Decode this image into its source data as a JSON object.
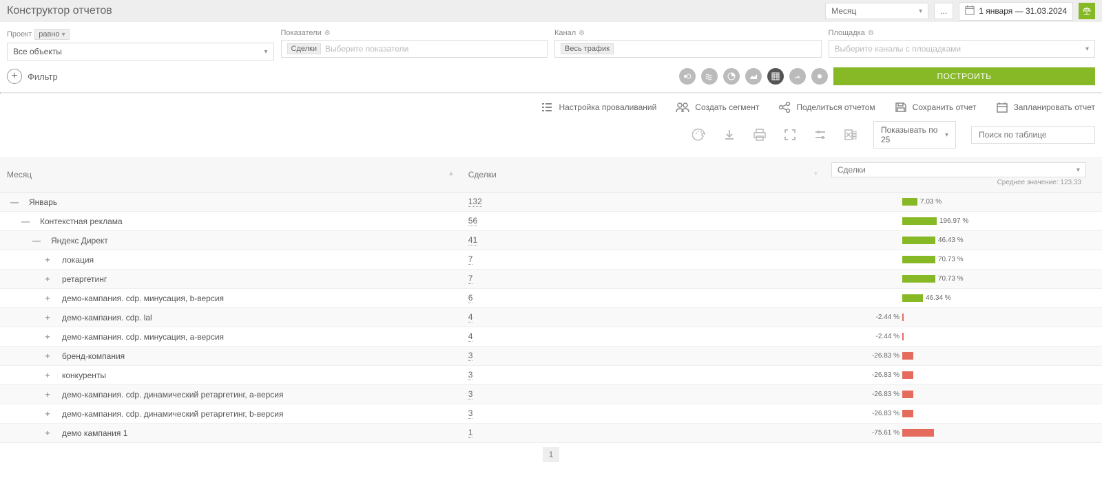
{
  "header": {
    "title": "Конструктор отчетов",
    "grouping_value": "Месяц",
    "date_range": "1 января — 31.03.2024",
    "ellipsis": "..."
  },
  "filters": {
    "project": {
      "label": "Проект",
      "op": "равно",
      "value": "Все объекты"
    },
    "metrics": {
      "label": "Показатели",
      "tag": "Сделки",
      "placeholder": "Выберите показатели"
    },
    "channel": {
      "label": "Канал",
      "tag": "Весь трафик"
    },
    "site": {
      "label": "Площадка",
      "placeholder": "Выберите каналы с площадками"
    },
    "add_filter": "Фильтр",
    "build": "ПОСТРОИТЬ"
  },
  "report_actions": {
    "drill": "Настройка проваливаний",
    "segment": "Создать сегмент",
    "share": "Поделиться отчетом",
    "save": "Сохранить отчет",
    "schedule": "Запланировать отчет"
  },
  "toolbar": {
    "page_size": "Показывать по 25",
    "search_placeholder": "Поиск по таблице"
  },
  "table": {
    "col_month": "Месяц",
    "col_deals": "Сделки",
    "metric_label": "Сделки",
    "avg_label": "Среднее значение: 123.33",
    "rows": [
      {
        "indent": 0,
        "exp": "—",
        "name": "Январь",
        "deals": "132",
        "pct": "7.03 %",
        "bar": 22,
        "dir": "pos",
        "alt": true
      },
      {
        "indent": 1,
        "exp": "—",
        "name": "Контекстная реклама",
        "deals": "56",
        "pct": "196.97 %",
        "bar": 50,
        "dir": "pos",
        "alt": false
      },
      {
        "indent": 2,
        "exp": "—",
        "name": "Яндекс Директ",
        "deals": "41",
        "pct": "46.43 %",
        "bar": 48,
        "dir": "pos",
        "alt": true
      },
      {
        "indent": 3,
        "exp": "+",
        "name": "локация",
        "deals": "7",
        "pct": "70.73 %",
        "bar": 48,
        "dir": "pos",
        "alt": false
      },
      {
        "indent": 3,
        "exp": "+",
        "name": "ретаргетинг",
        "deals": "7",
        "pct": "70.73 %",
        "bar": 48,
        "dir": "pos",
        "alt": true
      },
      {
        "indent": 3,
        "exp": "+",
        "name": "демо-кампания. cdp. минусация, b-версия",
        "deals": "6",
        "pct": "46.34 %",
        "bar": 30,
        "dir": "pos",
        "alt": false
      },
      {
        "indent": 3,
        "exp": "+",
        "name": "демо-кампания. cdp. lal",
        "deals": "4",
        "pct": "-2.44 %",
        "bar": 2,
        "dir": "neg",
        "alt": true
      },
      {
        "indent": 3,
        "exp": "+",
        "name": "демо-кампания. cdp. минусация, a-версия",
        "deals": "4",
        "pct": "-2.44 %",
        "bar": 2,
        "dir": "neg",
        "alt": false
      },
      {
        "indent": 3,
        "exp": "+",
        "name": "бренд-компания",
        "deals": "3",
        "pct": "-26.83 %",
        "bar": 16,
        "dir": "neg",
        "alt": true
      },
      {
        "indent": 3,
        "exp": "+",
        "name": "конкуренты",
        "deals": "3",
        "pct": "-26.83 %",
        "bar": 16,
        "dir": "neg",
        "alt": false
      },
      {
        "indent": 3,
        "exp": "+",
        "name": "демо-кампания. cdp. динамический ретаргетинг, a-версия",
        "deals": "3",
        "pct": "-26.83 %",
        "bar": 16,
        "dir": "neg",
        "alt": true
      },
      {
        "indent": 3,
        "exp": "+",
        "name": "демо-кампания. cdp. динамический ретаргетинг, b-версия",
        "deals": "3",
        "pct": "-26.83 %",
        "bar": 16,
        "dir": "neg",
        "alt": false
      },
      {
        "indent": 3,
        "exp": "+",
        "name": "демо кампания 1",
        "deals": "1",
        "pct": "-75.61 %",
        "bar": 46,
        "dir": "neg",
        "alt": true
      }
    ],
    "pager": "1"
  }
}
